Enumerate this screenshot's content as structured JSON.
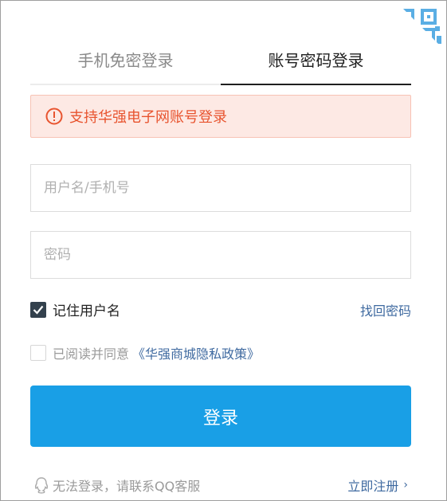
{
  "tabs": {
    "sms_login": "手机免密登录",
    "password_login": "账号密码登录",
    "active": "password_login"
  },
  "alert": {
    "icon": "exclamation-circle-icon",
    "text": "支持华强电子网账号登录",
    "color": "#e8542f"
  },
  "form": {
    "username_placeholder": "用户名/手机号",
    "username_value": "",
    "password_placeholder": "密码",
    "password_value": "",
    "remember_label": "记住用户名",
    "remember_checked": true,
    "forgot_label": "找回密码",
    "agree_label": "已阅读并同意",
    "policy_label": "《华强商城隐私政策》",
    "agree_checked": false,
    "submit_label": "登录"
  },
  "footer": {
    "help_icon": "qq-icon",
    "help_text": "无法登录，请联系QQ客服",
    "register_label": "立即注册",
    "register_icon": "chevron-right-icon"
  },
  "qr_switch": {
    "icon": "qr-code-icon"
  },
  "colors": {
    "primary": "#199fe6",
    "link": "#3f6aa0",
    "alert_bg": "#fde9e4"
  }
}
